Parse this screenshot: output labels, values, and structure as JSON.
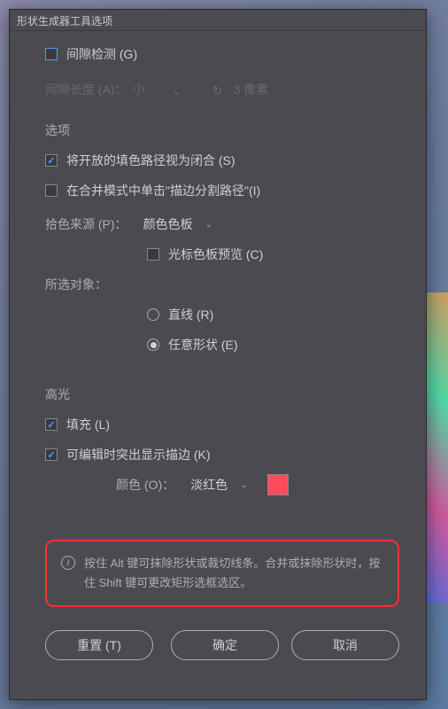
{
  "titlebar": "形状生成器工具选项",
  "gap_detection": {
    "label": "间隙检测 (G)",
    "checked": false
  },
  "gap_length": {
    "label": "间隙长度 (A)：",
    "value_label": "小",
    "unit_label": "3 像素"
  },
  "options": {
    "header": "选项",
    "open_path": {
      "label": "将开放的填色路径视为闭合 (S)",
      "checked": true
    },
    "merge_click": {
      "label": "在合并模式中单击\"描边分割路径\"(I)",
      "checked": false
    },
    "color_source": {
      "label": "拾色来源 (P)：",
      "value": "颜色色板"
    },
    "cursor_preview": {
      "label": "光标色板预览 (C)",
      "checked": false
    },
    "selection": {
      "label": "所选对象：",
      "line": {
        "label": "直线 (R)",
        "selected": false
      },
      "freeform": {
        "label": "任意形状 (E)",
        "selected": true
      }
    }
  },
  "highlight": {
    "header": "高光",
    "fill": {
      "label": "填充 (L)",
      "checked": true
    },
    "editing_stroke": {
      "label": "可编辑时突出显示描边 (K)",
      "checked": true
    },
    "color": {
      "label": "颜色 (O)：",
      "value": "淡红色",
      "swatch": "#ff4a5a"
    }
  },
  "info": {
    "text": "按住 Alt 键可抹除形状或裁切线条。合并或抹除形状时，按住 Shift 键可更改矩形选框选区。"
  },
  "buttons": {
    "reset": "重置 (T)",
    "ok": "确定",
    "cancel": "取消"
  }
}
